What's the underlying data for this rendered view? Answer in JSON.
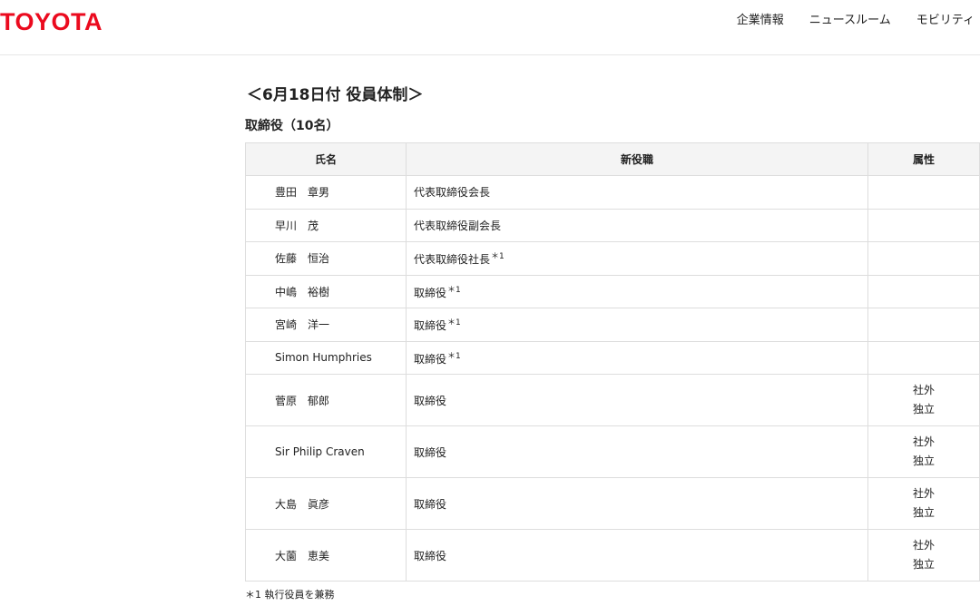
{
  "header": {
    "logo": "TOYOTA",
    "nav": [
      "企業情報",
      "ニュースルーム",
      "モビリティ"
    ]
  },
  "colors": {
    "brand": "#eb0a1e",
    "header_bg": "#f4f4f4",
    "border": "#dddddd"
  },
  "page": {
    "title": "＜6月18日付 役員体制＞",
    "section_title": "取締役（10名）"
  },
  "table": {
    "headers": [
      "氏名",
      "新役職",
      "属性"
    ],
    "rows": [
      {
        "name": "豊田　章男",
        "position": "代表取締役会長",
        "note": "",
        "attr": []
      },
      {
        "name": "早川　茂",
        "position": "代表取締役副会長",
        "note": "",
        "attr": []
      },
      {
        "name": "佐藤　恒治",
        "position": "代表取締役社長",
        "note": "＊1",
        "attr": []
      },
      {
        "name": "中嶋　裕樹",
        "position": "取締役",
        "note": "＊1",
        "attr": []
      },
      {
        "name": "宮崎　洋一",
        "position": "取締役",
        "note": "＊1",
        "attr": []
      },
      {
        "name": "Simon Humphries",
        "position": "取締役",
        "note": "＊1",
        "attr": []
      },
      {
        "name": "菅原　郁郎",
        "position": "取締役",
        "note": "",
        "attr": [
          "社外",
          "独立"
        ]
      },
      {
        "name": "Sir Philip Craven",
        "position": "取締役",
        "note": "",
        "attr": [
          "社外",
          "独立"
        ]
      },
      {
        "name": "大島　眞彦",
        "position": "取締役",
        "note": "",
        "attr": [
          "社外",
          "独立"
        ]
      },
      {
        "name": "大薗　恵美",
        "position": "取締役",
        "note": "",
        "attr": [
          "社外",
          "独立"
        ]
      }
    ]
  },
  "footnote": "＊1 執行役員を兼務"
}
